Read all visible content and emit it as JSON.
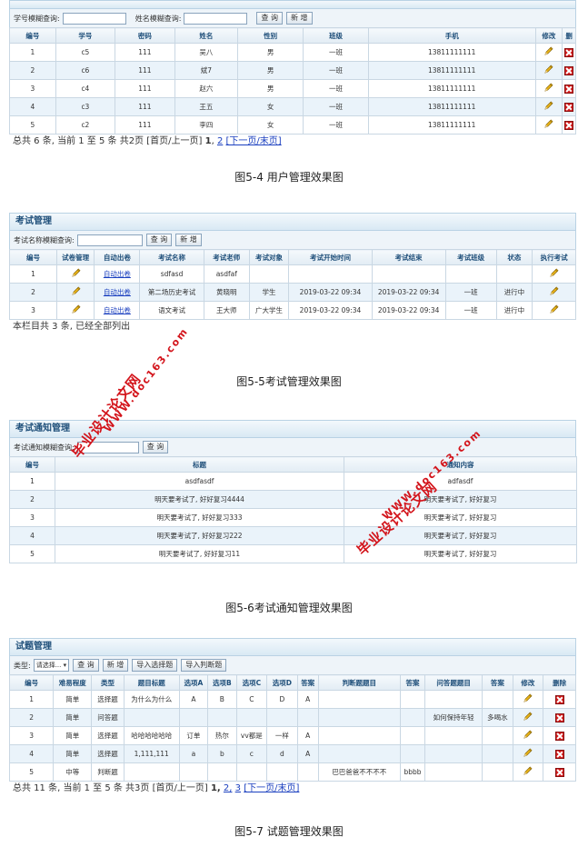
{
  "user_panel": {
    "search_id_label": "学号模糊查询:",
    "search_name_label": "姓名模糊查询:",
    "search_btn": "查 询",
    "add_btn": "新 增",
    "headers": [
      "编号",
      "学号",
      "密码",
      "姓名",
      "性别",
      "班级",
      "手机",
      "修改",
      "删"
    ],
    "rows": [
      [
        "1",
        "c5",
        "111",
        "吴八",
        "男",
        "一班",
        "13811111111"
      ],
      [
        "2",
        "c6",
        "111",
        "斌7",
        "男",
        "一班",
        "13811111111"
      ],
      [
        "3",
        "c4",
        "111",
        "赵六",
        "男",
        "一班",
        "13811111111"
      ],
      [
        "4",
        "c3",
        "111",
        "王五",
        "女",
        "一班",
        "13811111111"
      ],
      [
        "5",
        "c2",
        "111",
        "李四",
        "女",
        "一班",
        "13811111111"
      ]
    ],
    "pager_prefix": "总共 6 条, 当前 1 至 5 条 共2页",
    "pager_first": "[首页/上一页]",
    "page1": "1",
    "page2": "2",
    "pager_next": "[下一页/末页]",
    "caption": "图5-4 用户管理效果图"
  },
  "exam_panel": {
    "title": "考试管理",
    "search_label": "考试名称模糊查询:",
    "search_btn": "查 询",
    "add_btn": "新 增",
    "headers": [
      "编号",
      "试卷管理",
      "自动出卷",
      "考试名称",
      "考试老师",
      "考试对象",
      "考试开始时间",
      "考试结束",
      "考试班级",
      "状态",
      "执行考试"
    ],
    "auto_link": "自动出卷",
    "rows": [
      [
        "1",
        "sdfasd",
        "asdfaf",
        "",
        "",
        "",
        "",
        ""
      ],
      [
        "2",
        "第二场历史考试",
        "黄晓明",
        "学生",
        "2019-03-22 09:34",
        "2019-03-22 09:34",
        "一班",
        "进行中"
      ],
      [
        "3",
        "语文考试",
        "王大师",
        "广大学生",
        "2019-03-22 09:34",
        "2019-03-22 09:34",
        "一班",
        "进行中"
      ]
    ],
    "footer": "本栏目共 3 条, 已经全部列出",
    "caption": "图5-5考试管理效果图"
  },
  "notice_panel": {
    "title": "考试通知管理",
    "search_label": "考试通知模糊查询:",
    "search_btn": "查 询",
    "headers": [
      "编号",
      "标题",
      "通知内容"
    ],
    "rows": [
      [
        "1",
        "asdfasdf",
        "adfasdf"
      ],
      [
        "2",
        "明天要考试了, 好好复习4444",
        "明天要考试了, 好好复习"
      ],
      [
        "3",
        "明天要考试了, 好好复习333",
        "明天要考试了, 好好复习"
      ],
      [
        "4",
        "明天要考试了, 好好复习222",
        "明天要考试了, 好好复习"
      ],
      [
        "5",
        "明天要考试了, 好好复习11",
        "明天要考试了, 好好复习"
      ]
    ],
    "caption": "图5-6考试通知管理效果图"
  },
  "question_panel": {
    "title": "试题管理",
    "type_label": "类型:",
    "type_select": "请选择...",
    "search_btn": "查 询",
    "add_btn": "新 增",
    "import_choice_btn": "导入选择题",
    "import_judge_btn": "导入判断题",
    "headers": [
      "编号",
      "难易程度",
      "类型",
      "题目标题",
      "选项A",
      "选项B",
      "选项C",
      "选项D",
      "答案",
      "判断题题目",
      "答案",
      "问答题题目",
      "答案",
      "修改",
      "删除"
    ],
    "rows": [
      [
        "1",
        "简单",
        "选择题",
        "为什么为什么",
        "A",
        "B",
        "C",
        "D",
        "A",
        "",
        "",
        "",
        ""
      ],
      [
        "2",
        "简单",
        "问答题",
        "",
        "",
        "",
        "",
        "",
        "",
        "",
        "",
        "如何保持年轻",
        "多喝水"
      ],
      [
        "3",
        "简单",
        "选择题",
        "哈哈哈哈哈哈",
        "订单",
        "热尔",
        "vv都是",
        "一样",
        "A",
        "",
        "",
        "",
        ""
      ],
      [
        "4",
        "简单",
        "选择题",
        "1,111,111",
        "a",
        "b",
        "c",
        "d",
        "A",
        "",
        "",
        "",
        ""
      ],
      [
        "5",
        "中等",
        "判断题",
        "",
        "",
        "",
        "",
        "",
        "",
        "巴巴爸爸不不不不",
        "bbbb",
        "",
        ""
      ]
    ],
    "pager_prefix": "总共 11 条, 当前 1 至 5 条 共3页",
    "pager_first": "[首页/上一页]",
    "page1": "1,",
    "page2": "2,",
    "page3": "3",
    "pager_next": "[下一页/末页]",
    "caption": "图5-7 试题管理效果图"
  },
  "watermark": {
    "line1": "毕业设计论文网",
    "line2": "WWW.doc163.com"
  },
  "colors": {
    "accent": "#1f4f7a",
    "delete": "#d21d1d",
    "watermark": "#d3141b"
  },
  "icons": {
    "edit": "pencil-icon",
    "delete": "delete-icon"
  }
}
